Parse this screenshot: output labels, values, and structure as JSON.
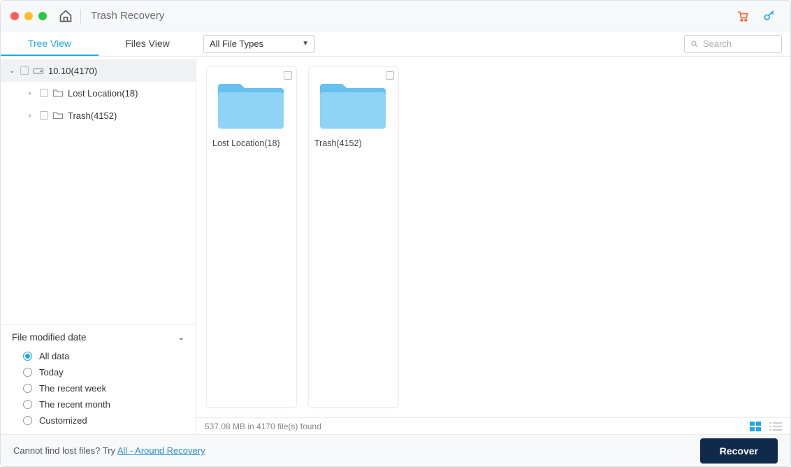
{
  "window": {
    "title": "Trash Recovery"
  },
  "toolbar": {
    "tabs": {
      "tree": "Tree View",
      "files": "Files View"
    },
    "filetype_selected": "All File Types",
    "search_placeholder": "Search"
  },
  "tree": {
    "root": {
      "label": "10.10(4170)"
    },
    "children": [
      {
        "label": "Lost Location(18)"
      },
      {
        "label": "Trash(4152)"
      }
    ]
  },
  "filter": {
    "heading": "File modified date",
    "options": [
      "All data",
      "Today",
      "The recent week",
      "The recent month",
      "Customized"
    ],
    "selected_index": 0
  },
  "grid": {
    "items": [
      {
        "label": "Lost Location(18)"
      },
      {
        "label": "Trash(4152)"
      }
    ]
  },
  "status": {
    "text": "537.08 MB in 4170 file(s) found"
  },
  "footer": {
    "prefix": "Cannot find lost files? Try ",
    "link_text": "All - Around Recovery",
    "recover_label": "Recover"
  }
}
